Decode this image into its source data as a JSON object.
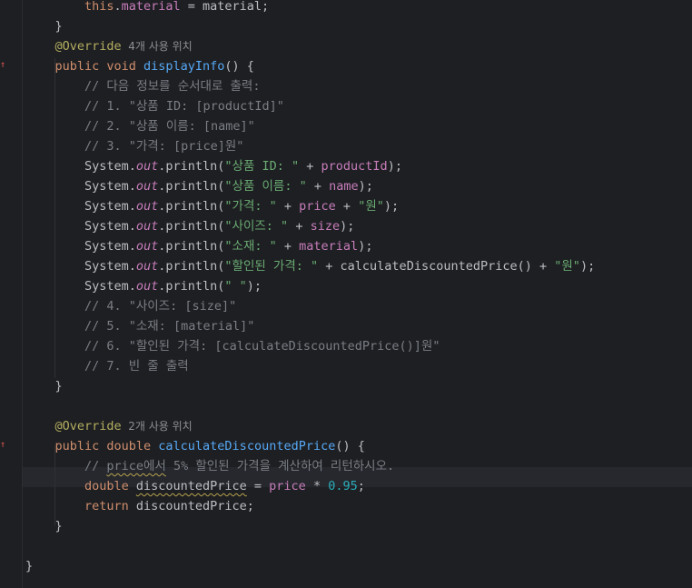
{
  "editor": {
    "lines": [
      {
        "indent": 8,
        "tokens": [
          {
            "t": "this",
            "c": "kw"
          },
          {
            "t": ".",
            "c": "plain"
          },
          {
            "t": "material",
            "c": "fld"
          },
          {
            "t": " = material;",
            "c": "plain"
          }
        ]
      },
      {
        "indent": 4,
        "tokens": [
          {
            "t": "}",
            "c": "plain"
          }
        ]
      },
      {
        "indent": 4,
        "tokens": [
          {
            "t": "@Override",
            "c": "ann"
          },
          {
            "t": "  4개 사용 위치",
            "c": "hint"
          }
        ]
      },
      {
        "indent": 4,
        "gutter": "override-marker",
        "tokens": [
          {
            "t": "public ",
            "c": "kw"
          },
          {
            "t": "void ",
            "c": "kw"
          },
          {
            "t": "displayInfo",
            "c": "fdecl"
          },
          {
            "t": "() {",
            "c": "plain"
          }
        ]
      },
      {
        "indent": 8,
        "tokens": [
          {
            "t": "// 다음 정보를 순서대로 출력:",
            "c": "cmt"
          }
        ]
      },
      {
        "indent": 8,
        "tokens": [
          {
            "t": "// 1. \"상품 ID: [productId]\"",
            "c": "cmt"
          }
        ]
      },
      {
        "indent": 8,
        "tokens": [
          {
            "t": "// 2. \"상품 이름: [name]\"",
            "c": "cmt"
          }
        ]
      },
      {
        "indent": 8,
        "tokens": [
          {
            "t": "// 3. \"가격: [price]원\"",
            "c": "cmt"
          }
        ]
      },
      {
        "indent": 8,
        "tokens": [
          {
            "t": "System.",
            "c": "plain"
          },
          {
            "t": "out",
            "c": "static"
          },
          {
            "t": ".println(",
            "c": "plain"
          },
          {
            "t": "\"상품 ID: \"",
            "c": "str"
          },
          {
            "t": " + ",
            "c": "plain"
          },
          {
            "t": "productId",
            "c": "fld"
          },
          {
            "t": ");",
            "c": "plain"
          }
        ]
      },
      {
        "indent": 8,
        "tokens": [
          {
            "t": "System.",
            "c": "plain"
          },
          {
            "t": "out",
            "c": "static"
          },
          {
            "t": ".println(",
            "c": "plain"
          },
          {
            "t": "\"상품 이름: \"",
            "c": "str"
          },
          {
            "t": " + ",
            "c": "plain"
          },
          {
            "t": "name",
            "c": "fld"
          },
          {
            "t": ");",
            "c": "plain"
          }
        ]
      },
      {
        "indent": 8,
        "tokens": [
          {
            "t": "System.",
            "c": "plain"
          },
          {
            "t": "out",
            "c": "static"
          },
          {
            "t": ".println(",
            "c": "plain"
          },
          {
            "t": "\"가격: \"",
            "c": "str"
          },
          {
            "t": " + ",
            "c": "plain"
          },
          {
            "t": "price",
            "c": "fld"
          },
          {
            "t": " + ",
            "c": "plain"
          },
          {
            "t": "\"원\"",
            "c": "str"
          },
          {
            "t": ");",
            "c": "plain"
          }
        ]
      },
      {
        "indent": 8,
        "tokens": [
          {
            "t": "System.",
            "c": "plain"
          },
          {
            "t": "out",
            "c": "static"
          },
          {
            "t": ".println(",
            "c": "plain"
          },
          {
            "t": "\"사이즈: \"",
            "c": "str"
          },
          {
            "t": " + ",
            "c": "plain"
          },
          {
            "t": "size",
            "c": "fld"
          },
          {
            "t": ");",
            "c": "plain"
          }
        ]
      },
      {
        "indent": 8,
        "tokens": [
          {
            "t": "System.",
            "c": "plain"
          },
          {
            "t": "out",
            "c": "static"
          },
          {
            "t": ".println(",
            "c": "plain"
          },
          {
            "t": "\"소재: \"",
            "c": "str"
          },
          {
            "t": " + ",
            "c": "plain"
          },
          {
            "t": "material",
            "c": "fld"
          },
          {
            "t": ");",
            "c": "plain"
          }
        ]
      },
      {
        "indent": 8,
        "tokens": [
          {
            "t": "System.",
            "c": "plain"
          },
          {
            "t": "out",
            "c": "static"
          },
          {
            "t": ".println(",
            "c": "plain"
          },
          {
            "t": "\"할인된 가격: \"",
            "c": "str"
          },
          {
            "t": " + calculateDiscountedPrice() + ",
            "c": "plain"
          },
          {
            "t": "\"원\"",
            "c": "str"
          },
          {
            "t": ");",
            "c": "plain"
          }
        ]
      },
      {
        "indent": 8,
        "tokens": [
          {
            "t": "System.",
            "c": "plain"
          },
          {
            "t": "out",
            "c": "static"
          },
          {
            "t": ".println(",
            "c": "plain"
          },
          {
            "t": "\" \"",
            "c": "str"
          },
          {
            "t": ");",
            "c": "plain"
          }
        ]
      },
      {
        "indent": 8,
        "tokens": [
          {
            "t": "// 4. \"사이즈: [size]\"",
            "c": "cmt"
          }
        ]
      },
      {
        "indent": 8,
        "tokens": [
          {
            "t": "// 5. \"소재: [material]\"",
            "c": "cmt"
          }
        ]
      },
      {
        "indent": 8,
        "tokens": [
          {
            "t": "// 6. \"할인된 가격: [calculateDiscountedPrice()]원\"",
            "c": "cmt"
          }
        ]
      },
      {
        "indent": 8,
        "tokens": [
          {
            "t": "// 7. 빈 줄 출력",
            "c": "cmt"
          }
        ]
      },
      {
        "indent": 4,
        "tokens": [
          {
            "t": "}",
            "c": "plain"
          }
        ]
      },
      {
        "indent": 0,
        "tokens": []
      },
      {
        "indent": 4,
        "tokens": [
          {
            "t": "@Override",
            "c": "ann"
          },
          {
            "t": "  2개 사용 위치",
            "c": "hint"
          }
        ]
      },
      {
        "indent": 4,
        "gutter": "override-marker",
        "tokens": [
          {
            "t": "public ",
            "c": "kw"
          },
          {
            "t": "double ",
            "c": "kw"
          },
          {
            "t": "calculateDiscountedPrice",
            "c": "fdecl"
          },
          {
            "t": "() {",
            "c": "plain"
          }
        ]
      },
      {
        "indent": 8,
        "tokens": [
          {
            "t": "// ",
            "c": "cmt"
          },
          {
            "t": "price에서",
            "c": "cmt",
            "squiggle": true
          },
          {
            "t": " 5% 할인된 가격을 계산하여 리턴하시오.",
            "c": "cmt"
          }
        ]
      },
      {
        "indent": 8,
        "current": true,
        "tokens": [
          {
            "t": "double ",
            "c": "kw"
          },
          {
            "t": "discountedPrice",
            "c": "plain",
            "squiggle": true
          },
          {
            "t": " = ",
            "c": "plain"
          },
          {
            "t": "price",
            "c": "fld"
          },
          {
            "t": " * ",
            "c": "plain"
          },
          {
            "t": "0.95",
            "c": "num"
          },
          {
            "t": ";",
            "c": "plain"
          }
        ]
      },
      {
        "indent": 8,
        "tokens": [
          {
            "t": "return ",
            "c": "kw"
          },
          {
            "t": "discountedPrice;",
            "c": "plain"
          }
        ]
      },
      {
        "indent": 4,
        "tokens": [
          {
            "t": "}",
            "c": "plain"
          }
        ]
      },
      {
        "indent": 0,
        "tokens": []
      },
      {
        "indent": 0,
        "tokens": [
          {
            "t": "}",
            "c": "plain"
          }
        ]
      }
    ]
  },
  "colors": {
    "background": "#1e1f22",
    "keyword": "#cf8e6d",
    "string": "#6aab73",
    "comment": "#7a7e85",
    "annotation": "#b3ae60",
    "method_declaration": "#56a8f5",
    "field": "#c77dbb",
    "number": "#2aacb8",
    "text": "#bcbec4"
  }
}
